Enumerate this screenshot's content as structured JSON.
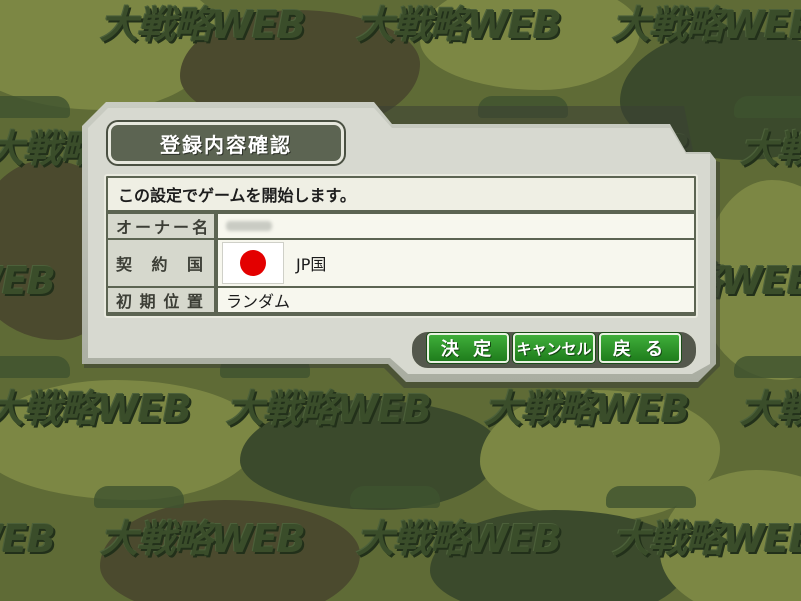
{
  "background": {
    "watermark": "大戦略WEB",
    "colors": {
      "dark": "#3b4a2c",
      "mid": "#5f6b36",
      "light": "#7c8744",
      "brown": "#4b4a2e"
    }
  },
  "dialog": {
    "title": "登録内容確認",
    "message": "この設定でゲームを開始します。",
    "fields": {
      "owner": {
        "label": "オーナー名",
        "value": ""
      },
      "country": {
        "label": "契 約 国",
        "flag_icon": "japan-flag-icon",
        "value": "JP国"
      },
      "position": {
        "label": "初期位置",
        "value": "ランダム"
      }
    },
    "buttons": {
      "decide": "決 定",
      "cancel": "キャンセル",
      "back": "戻 る"
    }
  }
}
